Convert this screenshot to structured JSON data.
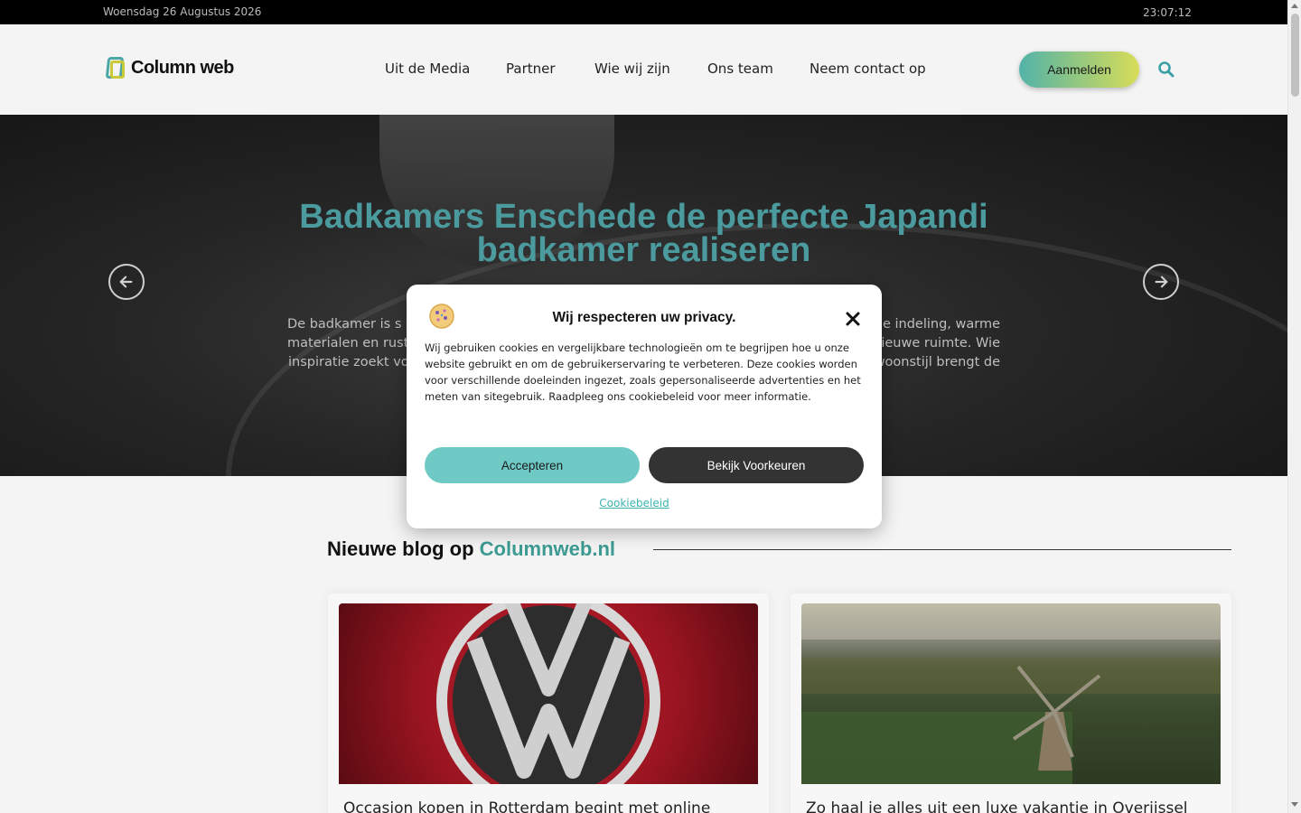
{
  "topbar": {
    "date": "Woensdag 26 Augustus 2026",
    "time": "23:07:12"
  },
  "header": {
    "logo_text": "Column web",
    "nav": [
      {
        "label": "Uit de Media"
      },
      {
        "label": "Partner"
      },
      {
        "label": "Wie wij zijn"
      },
      {
        "label": "Ons team"
      },
      {
        "label": "Neem contact op"
      }
    ],
    "signup_label": "Aanmelden",
    "search_icon": "search-icon"
  },
  "hero": {
    "title": "Badkamers Enschede de perfecte Japandi badkamer realiseren",
    "text_lines": [
      "De badkamer is s",
      "materialen en rust",
      "inspiratie zoekt voo",
      "e indeling, warme",
      "nieuwe ruimte. Wie",
      "woonstijl brengt de"
    ],
    "prev_icon": "arrow-left-icon",
    "next_icon": "arrow-right-icon"
  },
  "blog": {
    "heading_prefix": "Nieuwe blog op ",
    "heading_brand": "Columnweb.nl",
    "cards": [
      {
        "title": "Occasion kopen in Rotterdam begint met online"
      },
      {
        "title": "Zo haal je alles uit een luxe vakantie in Overijssel"
      }
    ]
  },
  "cookie_modal": {
    "title": "Wij respecteren uw privacy.",
    "body": "Wij gebruiken cookies en vergelijkbare technologieën om te begrijpen hoe u onze website gebruikt en om de gebruikerservaring te verbeteren. Deze cookies worden voor verschillende doeleinden ingezet, zoals gepersonaliseerde advertenties en het meten van sitegebruik. Raadpleeg ons cookiebeleid voor meer informatie.",
    "accept_label": "Accepteren",
    "prefs_label": "Bekijk Voorkeuren",
    "policy_label": "Cookiebeleid"
  },
  "colors": {
    "accent": "#4a9a9e",
    "accept": "#6fcac5",
    "dark_button": "#333333"
  }
}
